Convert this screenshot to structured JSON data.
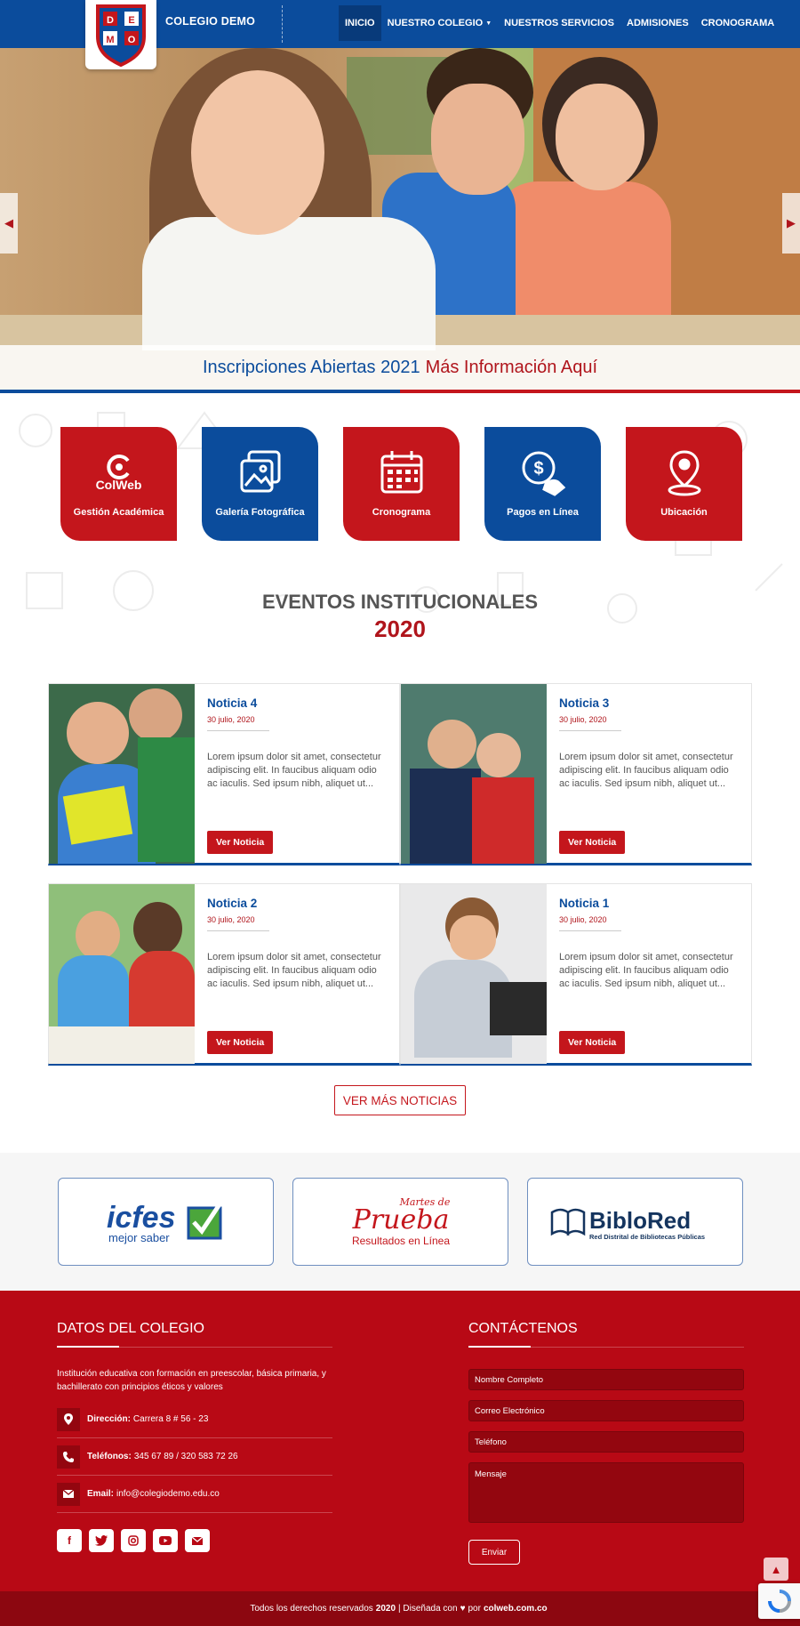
{
  "brand": {
    "name": "COLEGIO DEMO",
    "logo_letters": [
      "D",
      "E",
      "M",
      "O"
    ]
  },
  "nav": {
    "items": [
      {
        "label": "INICIO",
        "active": true
      },
      {
        "label": "NUESTRO COLEGIO",
        "dropdown": true
      },
      {
        "label": "NUESTROS SERVICIOS"
      },
      {
        "label": "ADMISIONES"
      },
      {
        "label": "CRONOGRAMA"
      }
    ]
  },
  "hero": {
    "caption_main": "Inscripciones Abiertas 2021",
    "caption_link": "Más Información Aquí",
    "prev_icon": "chevron-left-icon",
    "next_icon": "chevron-right-icon"
  },
  "quick_access": [
    {
      "label": "Gestión Académica",
      "logo_text": "ColWeb",
      "icon": "colweb-icon",
      "color": "#c4161c"
    },
    {
      "label": "Galería Fotográfica",
      "icon": "gallery-icon",
      "color": "#0b4c9c"
    },
    {
      "label": "Cronograma",
      "icon": "calendar-icon",
      "color": "#c4161c"
    },
    {
      "label": "Pagos en Línea",
      "icon": "payment-icon",
      "color": "#0b4c9c"
    },
    {
      "label": "Ubicación",
      "icon": "location-pin-icon",
      "color": "#c4161c"
    }
  ],
  "events": {
    "title": "EVENTOS INSTITUCIONALES",
    "year": "2020",
    "news": [
      {
        "title": "Noticia 4",
        "date": "30 julio, 2020",
        "text": "Lorem ipsum dolor sit amet, consectetur adipiscing elit. In faucibus aliquam odio ac iaculis. Sed ipsum nibh, aliquet ut...",
        "button": "Ver Noticia"
      },
      {
        "title": "Noticia 3",
        "date": "30 julio, 2020",
        "text": "Lorem ipsum dolor sit amet, consectetur adipiscing elit. In faucibus aliquam odio ac iaculis. Sed ipsum nibh, aliquet ut...",
        "button": "Ver Noticia"
      },
      {
        "title": "Noticia 2",
        "date": "30 julio, 2020",
        "text": "Lorem ipsum dolor sit amet, consectetur adipiscing elit. In faucibus aliquam odio ac iaculis. Sed ipsum nibh, aliquet ut...",
        "button": "Ver Noticia"
      },
      {
        "title": "Noticia 1",
        "date": "30 julio, 2020",
        "text": "Lorem ipsum dolor sit amet, consectetur adipiscing elit. In faucibus aliquam odio ac iaculis. Sed ipsum nibh, aliquet ut...",
        "button": "Ver Noticia"
      }
    ],
    "more_button": "VER MÁS NOTICIAS"
  },
  "partners": {
    "icfes": {
      "name": "icfes",
      "tagline": "mejor saber"
    },
    "prueba": {
      "top": "Martes de",
      "name": "Prueba",
      "tagline": "Resultados en Línea"
    },
    "biblored": {
      "name": "BibloRed",
      "tagline": "Red Distrital de Bibliotecas Públicas"
    }
  },
  "footer": {
    "school_title": "DATOS DEL COLEGIO",
    "description": "Institución educativa con formación en preescolar, básica primaria, y bachillerato con principios éticos y valores",
    "address_label": "Dirección:",
    "address": "Carrera 8 # 56 - 23",
    "phone_label": "Teléfonos:",
    "phones": "345 67 89 / 320 583 72 26",
    "email_label": "Email:",
    "email": "info@colegiodemo.edu.co",
    "socials": [
      "facebook-icon",
      "twitter-icon",
      "instagram-icon",
      "youtube-icon",
      "email-icon"
    ],
    "contact_title": "CONTÁCTENOS",
    "form": {
      "name_placeholder": "Nombre Completo",
      "email_placeholder": "Correo Electrónico",
      "phone_placeholder": "Teléfono",
      "message_placeholder": "Mensaje",
      "submit": "Enviar"
    },
    "copyright_prefix": "Todos los derechos reservados",
    "copyright_year": "2020",
    "designed_by": "| Diseñada con",
    "por": "por",
    "designer": "colweb.com.co"
  },
  "colors": {
    "blue": "#0b4c9c",
    "red": "#c4161c",
    "footer_red": "#b80915"
  }
}
